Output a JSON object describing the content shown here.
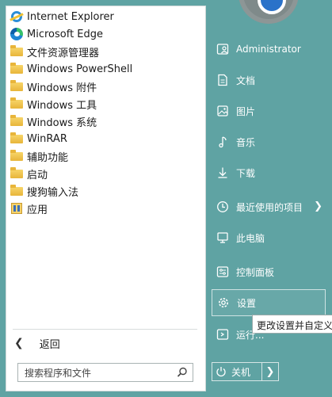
{
  "programs": [
    {
      "label": "Internet Explorer",
      "icon": "internet-explorer-icon"
    },
    {
      "label": "Microsoft Edge",
      "icon": "edge-icon"
    },
    {
      "label": "文件资源管理器",
      "icon": "folder-icon"
    },
    {
      "label": "Windows PowerShell",
      "icon": "folder-icon"
    },
    {
      "label": "Windows 附件",
      "icon": "folder-icon"
    },
    {
      "label": "Windows 工具",
      "icon": "folder-icon"
    },
    {
      "label": "Windows 系统",
      "icon": "folder-icon"
    },
    {
      "label": "WinRAR",
      "icon": "folder-icon"
    },
    {
      "label": "辅助功能",
      "icon": "folder-icon"
    },
    {
      "label": "启动",
      "icon": "folder-icon"
    },
    {
      "label": "搜狗输入法",
      "icon": "folder-icon"
    },
    {
      "label": "应用",
      "icon": "app-icon"
    }
  ],
  "back_label": "返回",
  "search": {
    "placeholder": "搜索程序和文件"
  },
  "right_items": [
    {
      "label": "Administrator",
      "icon": "user-folder-icon"
    },
    {
      "label": "文档",
      "icon": "document-icon"
    },
    {
      "label": "图片",
      "icon": "picture-icon"
    },
    {
      "label": "音乐",
      "icon": "music-icon"
    },
    {
      "label": "下载",
      "icon": "download-icon"
    },
    {
      "label": "最近使用的项目",
      "icon": "clock-icon"
    },
    {
      "label": "此电脑",
      "icon": "computer-icon"
    },
    {
      "label": "控制面板",
      "icon": "control-panel-icon"
    },
    {
      "label": "设置",
      "icon": "gear-icon"
    },
    {
      "label": "运行...",
      "icon": "run-icon"
    }
  ],
  "tooltip": "更改设置并自定义",
  "shutdown_label": "关机",
  "colors": {
    "background": "#5fa3a3",
    "panel": "#ffffff",
    "accent": "#2a72c9"
  }
}
